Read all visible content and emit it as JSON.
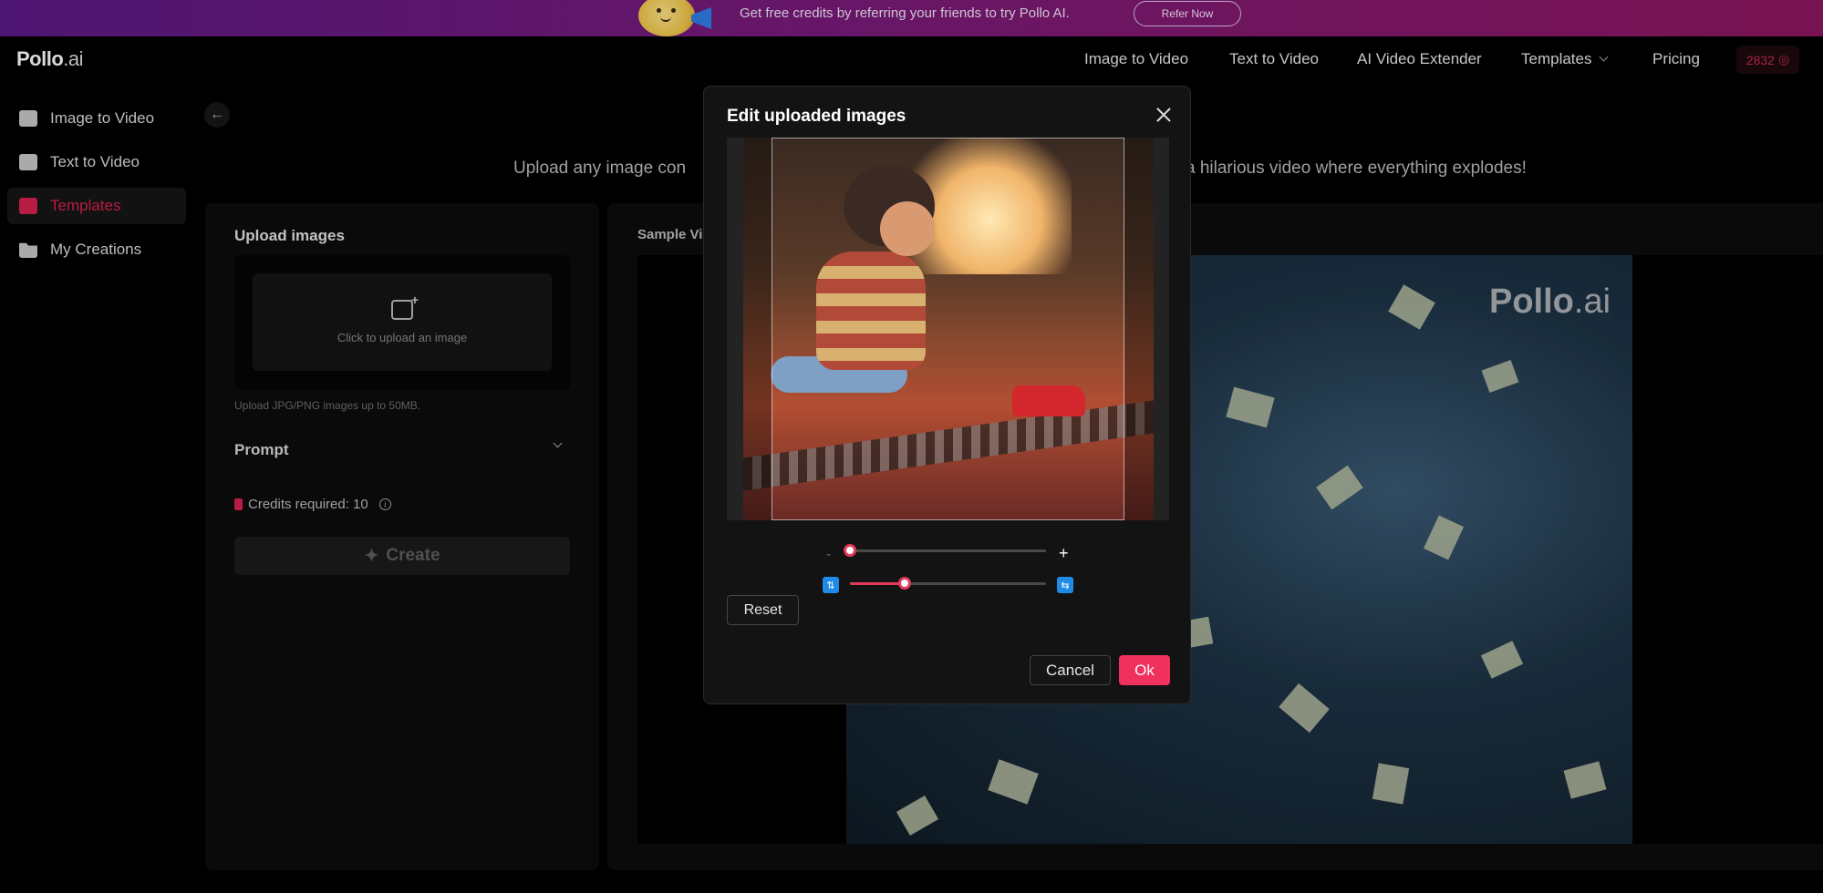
{
  "banner": {
    "text": "Get free credits by referring your friends to try Pollo AI.",
    "button_label": "Refer Now"
  },
  "header": {
    "logo_main": "Pollo",
    "logo_suffix": ".ai",
    "nav": [
      {
        "label": "Image to Video"
      },
      {
        "label": "Text to Video"
      },
      {
        "label": "AI Video Extender"
      },
      {
        "label": "Templates"
      },
      {
        "label": "Pricing"
      }
    ],
    "credits": "2832"
  },
  "sidebar": {
    "items": [
      {
        "label": "Image to Video",
        "icon": "image-video-icon"
      },
      {
        "label": "Text to Video",
        "icon": "text-video-icon"
      },
      {
        "label": "Templates",
        "icon": "templates-icon",
        "active": true
      },
      {
        "label": "My Creations",
        "icon": "folder-icon"
      }
    ]
  },
  "main": {
    "subtitle_left": "Upload any image con",
    "subtitle_right": "a hilarious video where everything explodes!",
    "upload": {
      "title": "Upload images",
      "box_text": "Click to upload an image",
      "hint": "Upload JPG/PNG images up to 50MB."
    },
    "prompt_label": "Prompt",
    "credits_required": "Credits required: 10",
    "create_label": "Create",
    "sample_label": "Sample Vi",
    "video_logo_main": "Pollo",
    "video_logo_suffix": ".ai"
  },
  "modal": {
    "title": "Edit uploaded images",
    "zoom_level": 0.0,
    "rotation_level": 0.28,
    "minus": "-",
    "plus": "+",
    "reset_label": "Reset",
    "cancel_label": "Cancel",
    "ok_label": "Ok"
  },
  "colors": {
    "accent": "#f0305d",
    "active_nav": "#d8234f",
    "rotate_icon": "#1e8be6"
  }
}
